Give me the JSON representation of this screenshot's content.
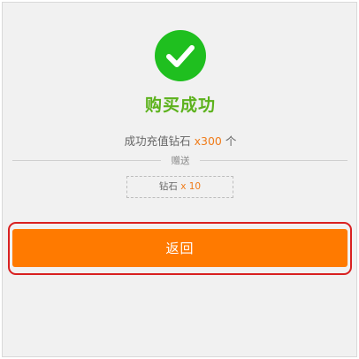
{
  "status": {
    "icon": "checkmark-circle-icon",
    "title": "购买成功"
  },
  "summary": {
    "text": "成功充值钻石",
    "quantity": "x300",
    "unit": "个"
  },
  "gift": {
    "label": "赠送",
    "item": "钻石",
    "quantity": "x 10"
  },
  "actions": {
    "back_label": "返回"
  },
  "colors": {
    "success_green": "#1fbf1f",
    "title_green": "#5cb21c",
    "accent_orange": "#ff7a00",
    "quantity_orange": "#f07c1a",
    "highlight_red": "#d92020"
  }
}
